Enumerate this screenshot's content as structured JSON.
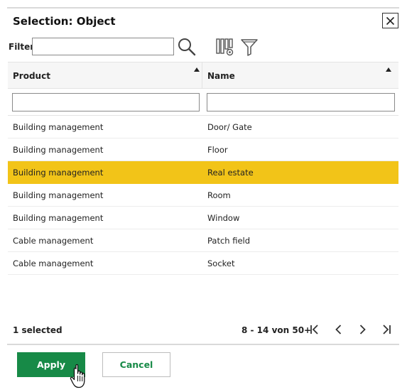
{
  "dialog": {
    "title": "Selection: Object",
    "close_icon": "close-icon"
  },
  "filter": {
    "label": "Filter",
    "value": "",
    "placeholder": "",
    "icons": [
      "search-icon",
      "columns-settings-icon",
      "filter-funnel-icon"
    ]
  },
  "grid": {
    "columns": [
      {
        "label": "Product",
        "sort": "ascending"
      },
      {
        "label": "Name",
        "sort": "ascending"
      }
    ],
    "column_filters": {
      "product": "",
      "name": ""
    },
    "rows": [
      {
        "product": "Building management",
        "name": "Door/ Gate",
        "selected": false
      },
      {
        "product": "Building management",
        "name": "Floor",
        "selected": false
      },
      {
        "product": "Building management",
        "name": "Real estate",
        "selected": true
      },
      {
        "product": "Building management",
        "name": "Room",
        "selected": false
      },
      {
        "product": "Building management",
        "name": "Window",
        "selected": false
      },
      {
        "product": "Cable management",
        "name": "Patch field",
        "selected": false
      },
      {
        "product": "Cable management",
        "name": "Socket",
        "selected": false
      }
    ],
    "selected_row_color": "#f2c418"
  },
  "footer": {
    "selected_text": "1 selected",
    "paging_text": "8 - 14 von 50+",
    "paging_icons": [
      "first-page-icon",
      "previous-page-icon",
      "next-page-icon",
      "last-page-icon"
    ]
  },
  "actions": {
    "apply_label": "Apply",
    "cancel_label": "Cancel",
    "accent_color": "#178a47"
  }
}
